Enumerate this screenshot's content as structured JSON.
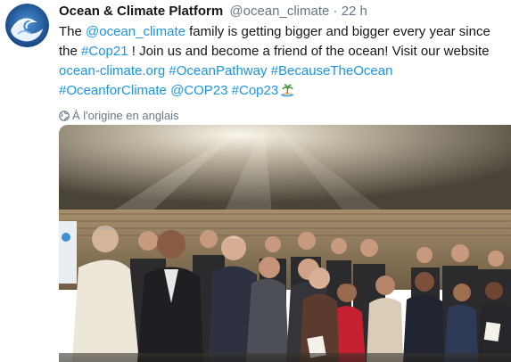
{
  "tweet": {
    "display_name": "Ocean & Climate Platform",
    "screen_name": "@ocean_climate",
    "separator": "·",
    "timestamp": "22 h",
    "text": {
      "t1": "The ",
      "mention": "@ocean_climate",
      "t2": " family is getting bigger and bigger every year since the ",
      "hashtag_cop21": "#Cop21",
      "t3": " ! Join us and become a friend of the ocean! Visit our website ",
      "link": "ocean-climate.org",
      "t4": " ",
      "hashtag_oceanpathway": "#OceanPathway",
      "t5": " ",
      "hashtag_becausetheocean": "#BecauseTheOcean",
      "t6": " ",
      "hashtag_oceanforclimate": "#OceanforClimate",
      "t7": " ",
      "hashtag_cop23_a": "@COP23",
      "t8": " ",
      "hashtag_cop23_b": "#Cop23",
      "emoji": "palm-island-emoji"
    },
    "translate_label": "À l'origine en anglais"
  },
  "colors": {
    "link": "#1b95e0",
    "secondary": "#657786",
    "primary_text": "#14171a",
    "avatar_bg": "#1a5aa0"
  },
  "icons": {
    "avatar": "ocean-wave-logo",
    "translate": "globe-icon",
    "emoji": "palm-island-emoji"
  },
  "media": {
    "type": "photo",
    "subject": "group-photo"
  }
}
